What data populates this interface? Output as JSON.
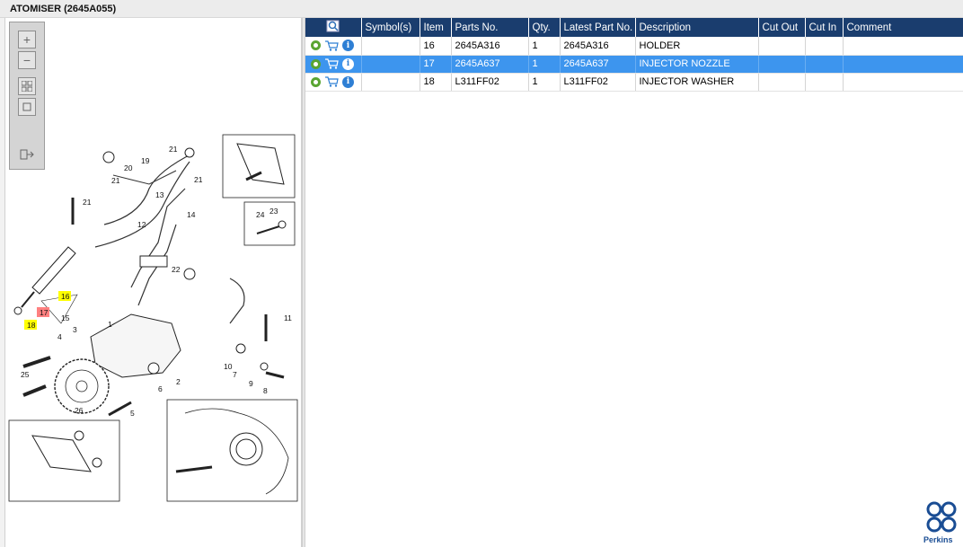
{
  "window": {
    "title": "ATOMISER (2645A055)"
  },
  "toolbar": {
    "zoom_in": "zoom-in-icon",
    "zoom_out": "zoom-out-icon",
    "fit": "fit-all-icon",
    "actual": "actual-size-icon",
    "export": "export-icon"
  },
  "table": {
    "headers": {
      "view": "",
      "symbols": "Symbol(s)",
      "item": "Item",
      "parts_no": "Parts No.",
      "qty": "Qty.",
      "latest": "Latest Part No.",
      "description": "Description",
      "cut_out": "Cut Out",
      "cut_in": "Cut In",
      "comment": "Comment"
    },
    "rows": [
      {
        "item": "16",
        "parts_no": "2645A316",
        "qty": "1",
        "latest": "2645A316",
        "description": "HOLDER",
        "cut_out": "",
        "cut_in": "",
        "comment": "",
        "symbols": "",
        "selected": false
      },
      {
        "item": "17",
        "parts_no": "2645A637",
        "qty": "1",
        "latest": "2645A637",
        "description": "INJECTOR NOZZLE",
        "cut_out": "",
        "cut_in": "",
        "comment": "",
        "symbols": "",
        "selected": true
      },
      {
        "item": "18",
        "parts_no": "L311FF02",
        "qty": "1",
        "latest": "L311FF02",
        "description": "INJECTOR WASHER",
        "cut_out": "",
        "cut_in": "",
        "comment": "",
        "symbols": "",
        "selected": false
      }
    ]
  },
  "diagram": {
    "callouts": [
      "21",
      "20",
      "19",
      "21",
      "13",
      "21",
      "14",
      "21",
      "12",
      "24",
      "23",
      "22",
      "16",
      "17",
      "18",
      "15",
      "1",
      "11",
      "3",
      "4",
      "10",
      "7",
      "9",
      "25",
      "6",
      "2",
      "8",
      "26",
      "5"
    ],
    "highlight_yellow": "#ffff00",
    "highlight_red": "#ff8080"
  },
  "brand": {
    "name": "Perkins",
    "color": "#1a4d94"
  },
  "colors": {
    "header_bg": "#1a3d6e",
    "selected_row": "#3d95ee"
  }
}
